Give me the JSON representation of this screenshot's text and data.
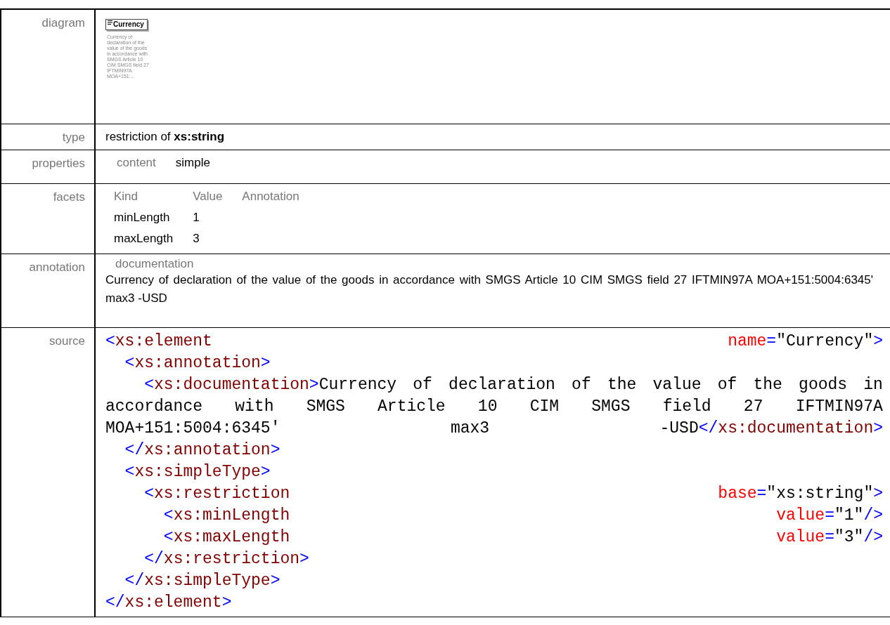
{
  "rows": [
    {
      "kind": "diagram",
      "label": "diagram",
      "element": {
        "name": "Currency",
        "note": "Currency of declaration of the value of the goods in accordance with  SMGS Article 10 CIM SMGS field 27 IFTMIN97A MOA+151:..."
      }
    },
    {
      "kind": "text",
      "label": "type",
      "text": "restriction of **xs:string**"
    },
    {
      "kind": "props",
      "label": "properties",
      "items": [
        {
          "name": "content",
          "value": "simple"
        }
      ]
    },
    {
      "kind": "facets",
      "label": "facets",
      "columns": [
        "Kind",
        "Value",
        "Annotation"
      ],
      "facets": [
        [
          "minLength",
          "1"
        ],
        [
          "maxLength",
          "3"
        ]
      ]
    },
    {
      "kind": "annotation",
      "label": "annotation",
      "heading": "documentation",
      "text": "Currency of declaration of the value of the goods in accordance with  SMGS Article 10 CIM SMGS field 27 IFTMIN97A MOA+151:5004:6345' max3 -USD"
    },
    {
      "kind": "source",
      "label": "source",
      "lines": [
        [
          [
            {
              "kind": "punct",
              "t": "<"
            },
            {
              "kind": "tag",
              "t": "xs:element"
            }
          ],
          [
            {
              "kind": "attr",
              "t": "name"
            },
            {
              "kind": "punct",
              "t": "="
            },
            {
              "kind": "text",
              "t": "\"Currency\""
            },
            {
              "kind": "punct",
              "t": ">"
            }
          ]
        ],
        [
          [
            {
              "kind": "punct",
              "t": "  <"
            },
            {
              "kind": "tag",
              "t": "xs:annotation"
            },
            {
              "kind": "punct",
              "t": ">"
            }
          ]
        ],
        [
          [
            {
              "kind": "punct",
              "t": "    <"
            },
            {
              "kind": "tag",
              "t": "xs:documentation"
            },
            {
              "kind": "punct",
              "t": ">"
            },
            {
              "kind": "text",
              "t": "Currency"
            }
          ],
          [
            {
              "kind": "text",
              "t": "of"
            }
          ],
          [
            {
              "kind": "text",
              "t": "declaration"
            }
          ],
          [
            {
              "kind": "text",
              "t": "of"
            }
          ],
          [
            {
              "kind": "text",
              "t": "the"
            }
          ],
          [
            {
              "kind": "text",
              "t": "value"
            }
          ],
          [
            {
              "kind": "text",
              "t": "of"
            }
          ],
          [
            {
              "kind": "text",
              "t": "the"
            }
          ],
          [
            {
              "kind": "text",
              "t": "goods"
            }
          ],
          [
            {
              "kind": "text",
              "t": "in"
            }
          ]
        ],
        [
          [
            {
              "kind": "text",
              "t": "accordance"
            }
          ],
          [
            {
              "kind": "text",
              "t": "with"
            }
          ],
          [
            {
              "kind": "text",
              "t": "SMGS"
            }
          ],
          [
            {
              "kind": "text",
              "t": "Article"
            }
          ],
          [
            {
              "kind": "text",
              "t": "10"
            }
          ],
          [
            {
              "kind": "text",
              "t": "CIM"
            }
          ],
          [
            {
              "kind": "text",
              "t": "SMGS"
            }
          ],
          [
            {
              "kind": "text",
              "t": "field"
            }
          ],
          [
            {
              "kind": "text",
              "t": "27"
            }
          ],
          [
            {
              "kind": "text",
              "t": "IFTMIN97A"
            }
          ]
        ],
        [
          [
            {
              "kind": "text",
              "t": "MOA+151:5004:6345'"
            }
          ],
          [
            {
              "kind": "text",
              "t": "max3"
            }
          ],
          [
            {
              "kind": "text",
              "t": "-USD"
            },
            {
              "kind": "punct",
              "t": "</"
            },
            {
              "kind": "tag",
              "t": "xs:documentation"
            },
            {
              "kind": "punct",
              "t": ">"
            }
          ]
        ],
        [
          [
            {
              "kind": "punct",
              "t": "  </"
            },
            {
              "kind": "tag",
              "t": "xs:annotation"
            },
            {
              "kind": "punct",
              "t": ">"
            }
          ]
        ],
        [
          [
            {
              "kind": "punct",
              "t": "  <"
            },
            {
              "kind": "tag",
              "t": "xs:simpleType"
            },
            {
              "kind": "punct",
              "t": ">"
            }
          ]
        ],
        [
          [
            {
              "kind": "punct",
              "t": "    <"
            },
            {
              "kind": "tag",
              "t": "xs:restriction"
            }
          ],
          [
            {
              "kind": "attr",
              "t": "base"
            },
            {
              "kind": "punct",
              "t": "="
            },
            {
              "kind": "text",
              "t": "\"xs:string\""
            },
            {
              "kind": "punct",
              "t": ">"
            }
          ]
        ],
        [
          [
            {
              "kind": "punct",
              "t": "      <"
            },
            {
              "kind": "tag",
              "t": "xs:minLength"
            }
          ],
          [
            {
              "kind": "attr",
              "t": "value"
            },
            {
              "kind": "punct",
              "t": "="
            },
            {
              "kind": "text",
              "t": "\"1\""
            },
            {
              "kind": "punct",
              "t": "/>"
            }
          ]
        ],
        [
          [
            {
              "kind": "punct",
              "t": "      <"
            },
            {
              "kind": "tag",
              "t": "xs:maxLength"
            }
          ],
          [
            {
              "kind": "attr",
              "t": "value"
            },
            {
              "kind": "punct",
              "t": "="
            },
            {
              "kind": "text",
              "t": "\"3\""
            },
            {
              "kind": "punct",
              "t": "/>"
            }
          ]
        ],
        [
          [
            {
              "kind": "punct",
              "t": "    </"
            },
            {
              "kind": "tag",
              "t": "xs:restriction"
            },
            {
              "kind": "punct",
              "t": ">"
            }
          ]
        ],
        [
          [
            {
              "kind": "punct",
              "t": "  </"
            },
            {
              "kind": "tag",
              "t": "xs:simpleType"
            },
            {
              "kind": "punct",
              "t": ">"
            }
          ]
        ],
        [
          [
            {
              "kind": "punct",
              "t": "</"
            },
            {
              "kind": "tag",
              "t": "xs:element"
            },
            {
              "kind": "punct",
              "t": ">"
            }
          ]
        ]
      ]
    }
  ]
}
